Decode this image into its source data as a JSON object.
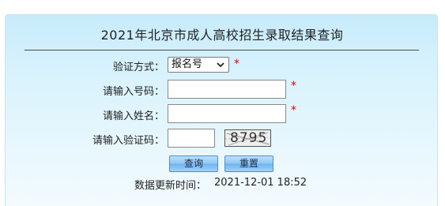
{
  "page": {
    "title": "2021年北京市成人高校招生录取结果查询"
  },
  "form": {
    "verify_method_label": "验证方式：",
    "verify_method_selected": "报名号",
    "number_label": "请输入号码：",
    "name_label": "请输入姓名：",
    "captcha_label": "请输入验证码：",
    "required_mark": "*",
    "captcha_text": "8795",
    "number_value": "",
    "name_value": "",
    "captcha_value": ""
  },
  "buttons": {
    "query": "查询",
    "reset": "重置"
  },
  "footer": {
    "update_label": "数据更新时间：",
    "update_time": "2021-12-01 18:52"
  },
  "colors": {
    "panel_bg_top": "#c7ebfb",
    "required_red": "#e00000",
    "button_blue": "#8cc6f3"
  }
}
